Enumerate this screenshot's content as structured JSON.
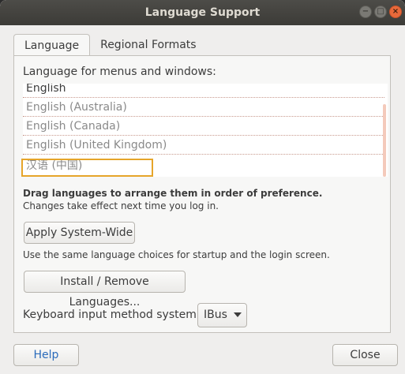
{
  "window": {
    "title": "Language Support",
    "controls": {
      "minimize": "−",
      "maximize": "□",
      "close": "×"
    }
  },
  "tabs": [
    {
      "label": "Language",
      "active": true
    },
    {
      "label": "Regional Formats",
      "active": false
    }
  ],
  "language": {
    "heading": "Language for menus and windows:",
    "items": [
      "English",
      "English (Australia)",
      "English (Canada)",
      "English (United Kingdom)",
      "汉语 (中国)"
    ],
    "hint_bold": "Drag languages to arrange them in order of preference.",
    "hint": "Changes take effect next time you log in.",
    "highlight_color": "#e6a52a"
  },
  "buttons": {
    "apply": "Apply System-Wide",
    "apply_note": "Use the same language choices for startup and the login screen.",
    "install": "Install / Remove Languages...",
    "help": "Help",
    "close": "Close"
  },
  "keyboard": {
    "label": "Keyboard input method system:",
    "value": "IBus"
  }
}
